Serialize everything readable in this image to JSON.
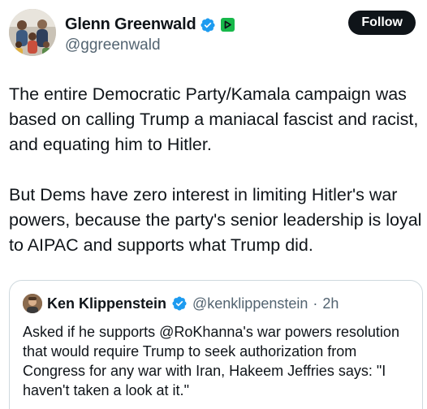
{
  "author": {
    "display_name": "Glenn Greenwald",
    "handle": "@ggreenwald",
    "verified_icon": "verified-badge-icon",
    "affiliate_icon": "rumble-play-icon"
  },
  "follow_label": "Follow",
  "tweet": {
    "paragraphs": [
      "The entire Democratic Party/Kamala campaign was based on calling Trump a maniacal fascist and racist, and equating him to Hitler.",
      "But Dems have zero interest in limiting Hitler's war powers, because the party's senior leadership is loyal to AIPAC and supports what Trump did."
    ]
  },
  "quote": {
    "display_name": "Ken Klippenstein",
    "handle": "@kenklippenstein",
    "separator": "·",
    "time": "2h",
    "text": "Asked if he supports @RoKhanna's war powers resolution that would require Trump to seek authorization from Congress for any war with Iran, Hakeem Jeffries says: \"I haven't taken a look at it.\""
  },
  "colors": {
    "text_primary": "#0f1419",
    "text_secondary": "#536471",
    "verified_blue": "#1d9bf0",
    "affiliate_green": "#17b84a",
    "border": "#cfd9de"
  }
}
